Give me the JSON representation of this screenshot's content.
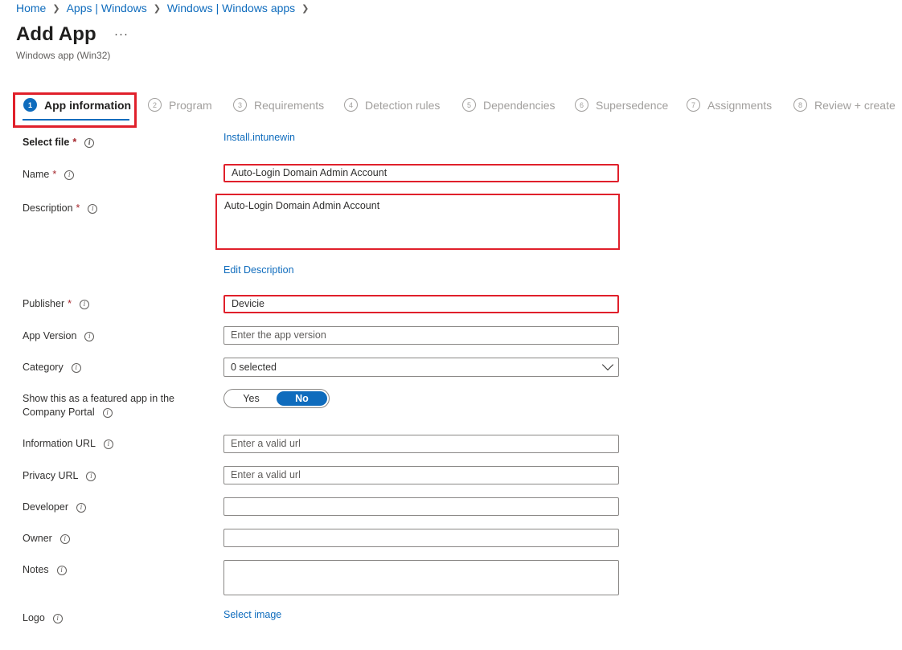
{
  "breadcrumb": [
    "Home",
    "Apps | Windows",
    "Windows | Windows apps"
  ],
  "title": "Add App",
  "more_label": "···",
  "subtitle": "Windows app (Win32)",
  "steps": [
    {
      "num": "1",
      "label": "App information"
    },
    {
      "num": "2",
      "label": "Program"
    },
    {
      "num": "3",
      "label": "Requirements"
    },
    {
      "num": "4",
      "label": "Detection rules"
    },
    {
      "num": "5",
      "label": "Dependencies"
    },
    {
      "num": "6",
      "label": "Supersedence"
    },
    {
      "num": "7",
      "label": "Assignments"
    },
    {
      "num": "8",
      "label": "Review + create"
    }
  ],
  "form": {
    "select_file": {
      "label": "Select file",
      "value": "Install.intunewin"
    },
    "name": {
      "label": "Name",
      "value": "Auto-Login Domain Admin Account"
    },
    "description": {
      "label": "Description",
      "value": "Auto-Login Domain Admin Account",
      "edit_link": "Edit Description"
    },
    "publisher": {
      "label": "Publisher",
      "value": "Devicie"
    },
    "app_version": {
      "label": "App Version",
      "placeholder": "Enter the app version"
    },
    "category": {
      "label": "Category",
      "value": "0 selected"
    },
    "featured": {
      "label_line1": "Show this as a featured app in the",
      "label_line2": "Company Portal",
      "yes": "Yes",
      "no": "No",
      "selected": "No"
    },
    "information_url": {
      "label": "Information URL",
      "placeholder": "Enter a valid url"
    },
    "privacy_url": {
      "label": "Privacy URL",
      "placeholder": "Enter a valid url"
    },
    "developer": {
      "label": "Developer",
      "value": ""
    },
    "owner": {
      "label": "Owner",
      "value": ""
    },
    "notes": {
      "label": "Notes",
      "value": ""
    },
    "logo": {
      "label": "Logo",
      "link": "Select image"
    }
  },
  "required_mark": "*",
  "info_glyph": "i",
  "colors": {
    "accent": "#0f6cbd",
    "highlight": "#e0202b",
    "required": "#a4262c"
  }
}
